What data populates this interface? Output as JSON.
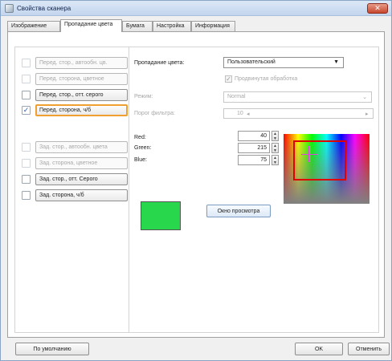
{
  "window": {
    "title": "Свойства сканера",
    "close_glyph": "✕",
    "icon": "scanner-icon"
  },
  "tabs": [
    "Изображение",
    "Пропадание цвета",
    "Бумага",
    "Настройка",
    "Информация"
  ],
  "modes": [
    {
      "label": "Перед. стор., автообн. цв.",
      "checked": false,
      "enabled": false,
      "selected": false
    },
    {
      "label": "Перед. сторона, цветное",
      "checked": false,
      "enabled": false,
      "selected": false
    },
    {
      "label": "Перед. стор., отт. серого",
      "checked": false,
      "enabled": true,
      "selected": false
    },
    {
      "label": "Перед. сторона, ч/б",
      "checked": true,
      "enabled": true,
      "selected": true
    },
    {
      "label": "Зад. стор., автообн. цвета",
      "checked": false,
      "enabled": false,
      "selected": false
    },
    {
      "label": "Зад. сторона, цветное",
      "checked": false,
      "enabled": false,
      "selected": false
    },
    {
      "label": "Зад. стор., отт. Серого",
      "checked": false,
      "enabled": true,
      "selected": false
    },
    {
      "label": "Зад. сторона, ч/б",
      "checked": false,
      "enabled": true,
      "selected": false
    }
  ],
  "dropout": {
    "label": "Пропадание цвета:",
    "value": "Пользовательский",
    "advanced_label": "Продвинутая обработка",
    "advanced_checked": true,
    "mode_label": "Режим:",
    "mode_value": "Normal",
    "filter_label": "Порог фильтра:",
    "filter_value": "10"
  },
  "rgb": {
    "red_label": "Red:",
    "red_value": "40",
    "green_label": "Green:",
    "green_value": "215",
    "blue_label": "Blue:",
    "blue_value": "75",
    "swatch_color": "#28d74b"
  },
  "preview_button": "Окно просмотра",
  "footer": {
    "default_button": "По умолчанию",
    "ok_button": "OK",
    "cancel_button": "Отменить"
  },
  "colors": {
    "accent_selected": "#f0a030",
    "picker_frame": "#e00000"
  }
}
